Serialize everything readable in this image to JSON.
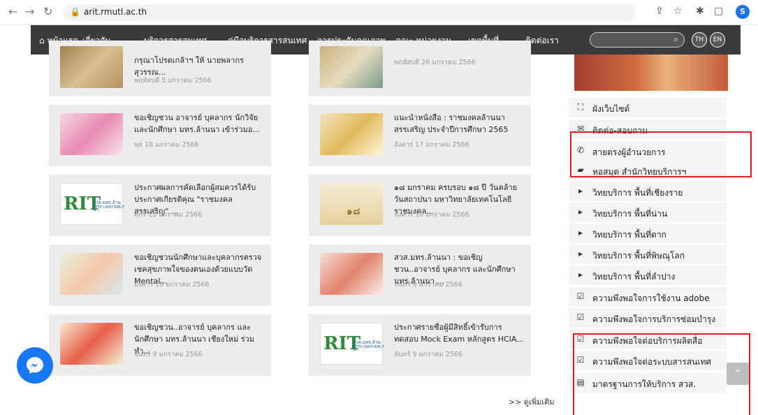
{
  "browser": {
    "url": "arit.rmutl.ac.th",
    "profile_initial": "S"
  },
  "nav": {
    "home": "หน้าแรก",
    "items": [
      "เกี่ยวกับ ⌄",
      "บริการสารสนเทศ ⌄",
      "คู่มือบริการสารสนเทศ ⌄",
      "การประกันคุณภาพ ⌄",
      "คณะ หน่วยงาน ⌄",
      "เขตพื้นที่ ⌄",
      "ติดต่อเรา"
    ],
    "lang_th": "TH",
    "lang_en": "EN"
  },
  "news": [
    {
      "title": "กรุณาโปรดเกล้าฯ ให้ นายพลากร สุวรรณ...",
      "date": "พฤหัสบดี 5 มกราคม 2566"
    },
    {
      "title": "",
      "date": "พฤหัสบดี 26 มกราคม 2566"
    },
    {
      "title": "ขอเชิญชวน อาจารย์ บุคลากร นักวิจัย และนักศึกษา มทร.ล้านนา เข้าร่วมอ...",
      "date": "พุธ 18 มกราคม 2566"
    },
    {
      "title": "แนะนำหนังสือ : ราชมงคลล้านนาสรรเสริญ ประจำปีการศึกษา 2565",
      "date": "อังคาร 17 มกราคม 2566"
    },
    {
      "title": "ประกาศผลการคัดเลือกผู้สมควรได้รับประกาศเกียรติคุณ \"ราชมงคลสรรเสริญ\" ...",
      "date": "ศุกร์ 13 มกราคม 2566"
    },
    {
      "title": "๑๘ มกราคม ครบรอบ ๑๘ ปี วันคล้ายวันสถาปนา มหาวิทยาลัยเทคโนโลยีราชมงคล...",
      "date": "อังคาร 10 มกราคม 2566"
    },
    {
      "title": "ขอเชิญชวนนักศึกษาและบุคลากรตรวจเชคสุขภาพใจของตนเองด้วยแบบวัด Mental...",
      "date": "อังคาร 10 มกราคม 2566"
    },
    {
      "title": "สวส.มทร.ล้านนา : ขอเชิญชวน..อาจารย์ บุคลากร และนักศึกษา มทร.ล้านนา ...",
      "date": "จันทร์ 9 มกราคม 2566"
    },
    {
      "title": "ขอเชิญชวน..อาจารย์ บุคลากร และนักศึกษา มทร.ล้านนา เชียงใหม่ ร่วมทำ...",
      "date": "จันทร์ 9 มกราคม 2566"
    },
    {
      "title": "ประกาศรายชื่อผู้มีสิทธิ์เข้ารับการทดสอบ Mock Exam หลักสูตร HCIA...",
      "date": "จันทร์ 9 มกราคม 2566"
    }
  ],
  "thumb_text": {
    "rit_a": "สวส.มทร.ล้านนา",
    "rit_b": "HTTP://ARIT.RMUT",
    "anniv": "๑๘"
  },
  "more_link": ">> ดูเพิ่มเติม",
  "sidebar": [
    {
      "icon": "sitemap-icon",
      "glyph": "⛶",
      "label": "ผังเว็บไซต์"
    },
    {
      "icon": "envelope-icon",
      "glyph": "✉",
      "label": "ติดต่อ-สอบถาม"
    },
    {
      "icon": "phone-icon",
      "glyph": "✆",
      "label": "สายตรงผู้อำนวยการ"
    },
    {
      "icon": "book-icon",
      "glyph": "▰",
      "label": "หอสมุด สำนักวิทยบริการฯ"
    },
    {
      "icon": "caret-right-icon",
      "glyph": "▸",
      "label": "วิทยบริการ พื้นที่เชียงราย"
    },
    {
      "icon": "caret-right-icon",
      "glyph": "▸",
      "label": "วิทยบริการ พื้นที่น่าน"
    },
    {
      "icon": "caret-right-icon",
      "glyph": "▸",
      "label": "วิทยบริการ พื้นที่ตาก"
    },
    {
      "icon": "caret-right-icon",
      "glyph": "▸",
      "label": "วิทยบริการ พื้นที่พิษณุโลก"
    },
    {
      "icon": "caret-right-icon",
      "glyph": "▸",
      "label": "วิทยบริการ พื้นที่ลำปาง"
    },
    {
      "icon": "check-square-icon",
      "glyph": "☑",
      "label": "ความพึงพอใจการใช้งาน adobe"
    },
    {
      "icon": "check-square-icon",
      "glyph": "☑",
      "label": "ความพึงพอใจการบริการซ่อมบำรุง"
    },
    {
      "icon": "check-square-icon",
      "glyph": "☑",
      "label": "ความพึงพอใจต่อบริการผลิตสื่อ"
    },
    {
      "icon": "check-square-icon",
      "glyph": "☑",
      "label": "ความพึงพอใจต่อระบบสารสนเทศ"
    },
    {
      "icon": "document-icon",
      "glyph": "▤",
      "label": "มาตรฐานการให้บริการ สวส."
    }
  ],
  "colors": {
    "nav_bg": "#3b3b3b",
    "card_bg": "#ececec",
    "highlight": "#e31b23",
    "messenger": "#1877f2"
  }
}
